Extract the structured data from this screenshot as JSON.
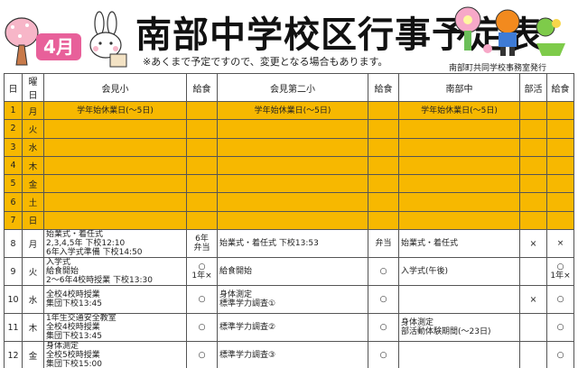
{
  "header": {
    "title": "南部中学校区行事予定表",
    "month_label": "4月",
    "subtitle": "※あくまで予定ですので、変更となる場合もあります。",
    "issuer": "南部町共同学校事務室発行"
  },
  "columns": [
    "日",
    "曜日",
    "会見小",
    "給食",
    "会見第二小",
    "給食",
    "南部中",
    "部活",
    "給食"
  ],
  "rows": [
    {
      "day": "1",
      "dow": "月",
      "a": "学年始休業日(～5日)",
      "a_l": "",
      "b": "学年始休業日(～5日)",
      "b_l": "",
      "c": "学年始休業日(～5日)",
      "c_club": "",
      "c_l": "",
      "yellow": true
    },
    {
      "day": "2",
      "dow": "火",
      "a": "",
      "a_l": "",
      "b": "",
      "b_l": "",
      "c": "",
      "c_club": "",
      "c_l": "",
      "yellow": true
    },
    {
      "day": "3",
      "dow": "水",
      "a": "",
      "a_l": "",
      "b": "",
      "b_l": "",
      "c": "",
      "c_club": "",
      "c_l": "",
      "yellow": true
    },
    {
      "day": "4",
      "dow": "木",
      "a": "",
      "a_l": "",
      "b": "",
      "b_l": "",
      "c": "",
      "c_club": "",
      "c_l": "",
      "yellow": true
    },
    {
      "day": "5",
      "dow": "金",
      "a": "",
      "a_l": "",
      "b": "",
      "b_l": "",
      "c": "",
      "c_club": "",
      "c_l": "",
      "yellow": true
    },
    {
      "day": "6",
      "dow": "土",
      "a": "",
      "a_l": "",
      "b": "",
      "b_l": "",
      "c": "",
      "c_club": "",
      "c_l": "",
      "yellow": true
    },
    {
      "day": "7",
      "dow": "日",
      "a": "",
      "a_l": "",
      "b": "",
      "b_l": "",
      "c": "",
      "c_club": "",
      "c_l": "",
      "yellow": true
    },
    {
      "day": "8",
      "dow": "月",
      "a": "始業式・着任式\n2,3,4,5年 下校12:10\n6年入学式準備 下校14:50",
      "a_l": "6年\n弁当",
      "b": "始業式・着任式 下校13:53",
      "b_l": "弁当",
      "c": "始業式・着任式",
      "c_club": "×",
      "c_l": "×",
      "yellow": false
    },
    {
      "day": "9",
      "dow": "火",
      "a": "入学式\n給食開始\n2～6年4校時授業 下校13:30",
      "a_l": "○\n1年×",
      "b": "給食開始",
      "b_l": "○",
      "c": "入学式(午後)",
      "c_club": "",
      "c_l": "○\n1年×",
      "yellow": false
    },
    {
      "day": "10",
      "dow": "水",
      "a": "全校4校時授業\n集団下校13:45",
      "a_l": "○",
      "b": "身体測定\n標準学力調査①",
      "b_l": "○",
      "c": "",
      "c_club": "×",
      "c_l": "○",
      "yellow": false
    },
    {
      "day": "11",
      "dow": "木",
      "a": "1年生交通安全教室\n全校4校時授業\n集団下校13:45",
      "a_l": "○",
      "b": "標準学力調査②",
      "b_l": "○",
      "c": "身体測定\n部活動体験期間(～23日)",
      "c_club": "",
      "c_l": "○",
      "yellow": false
    },
    {
      "day": "12",
      "dow": "金",
      "a": "身体測定\n全校5校時授業\n集団下校15:00",
      "a_l": "○",
      "b": "標準学力調査③",
      "b_l": "○",
      "c": "",
      "c_club": "",
      "c_l": "○",
      "yellow": false
    }
  ]
}
